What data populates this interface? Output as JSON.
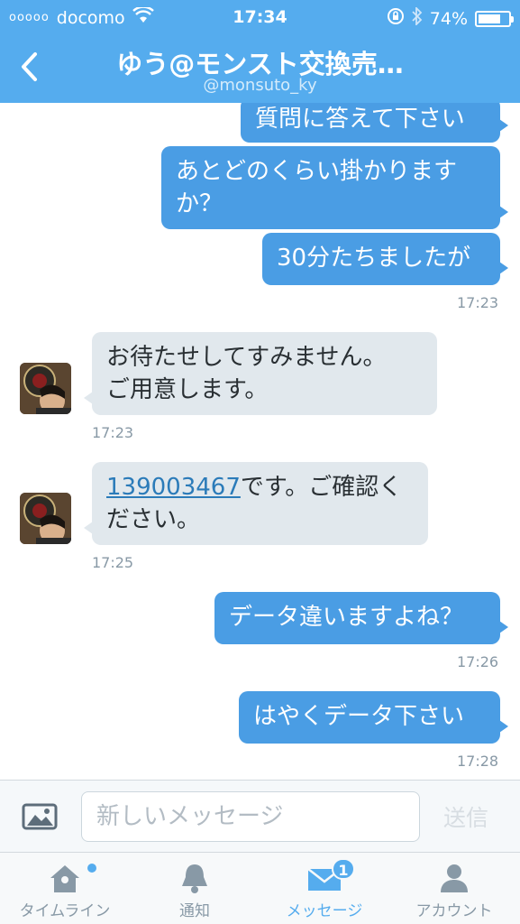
{
  "status_bar": {
    "signal": "ooooo",
    "carrier": "docomo",
    "time": "17:34",
    "battery_percent": "74%",
    "battery_level": 0.74,
    "icons": [
      "wifi-icon",
      "orientation-lock-icon",
      "bluetooth-icon",
      "battery-icon"
    ]
  },
  "nav": {
    "title": "ゆう@モンスト交換売…",
    "subtitle": "@monsuto_ky"
  },
  "messages": [
    {
      "direction": "out",
      "text": "質問に答えて下さい"
    },
    {
      "direction": "out",
      "lines": [
        "あとどのくらい掛かります",
        "か？"
      ]
    },
    {
      "direction": "out",
      "text": "30分たちましたが",
      "time": "17:23"
    },
    {
      "direction": "in",
      "lines": [
        "お待たせしてすみません。",
        "ご用意します。"
      ],
      "time": "17:23"
    },
    {
      "direction": "in",
      "link": "139003467",
      "line1_rest": "です。ご確認く",
      "line2": "ださい。",
      "time": "17:25"
    },
    {
      "direction": "out",
      "text": "データ違いますよね？",
      "time": "17:26"
    },
    {
      "direction": "out",
      "text": "はやくデータ下さい",
      "time": "17:28"
    }
  ],
  "composer": {
    "placeholder": "新しいメッセージ",
    "send_label": "送信"
  },
  "tabs": [
    {
      "label": "タイムライン",
      "icon": "home-icon",
      "active": false,
      "has_dot": true
    },
    {
      "label": "通知",
      "icon": "bell-icon",
      "active": false
    },
    {
      "label": "メッセージ",
      "icon": "envelope-icon",
      "active": true,
      "badge": "1"
    },
    {
      "label": "アカウント",
      "icon": "person-icon",
      "active": false
    }
  ],
  "colors": {
    "brand": "#55acee",
    "outgoing_bubble": "#4a9de4",
    "incoming_bubble": "#e1e8ed",
    "timestamp": "#8899a6"
  }
}
